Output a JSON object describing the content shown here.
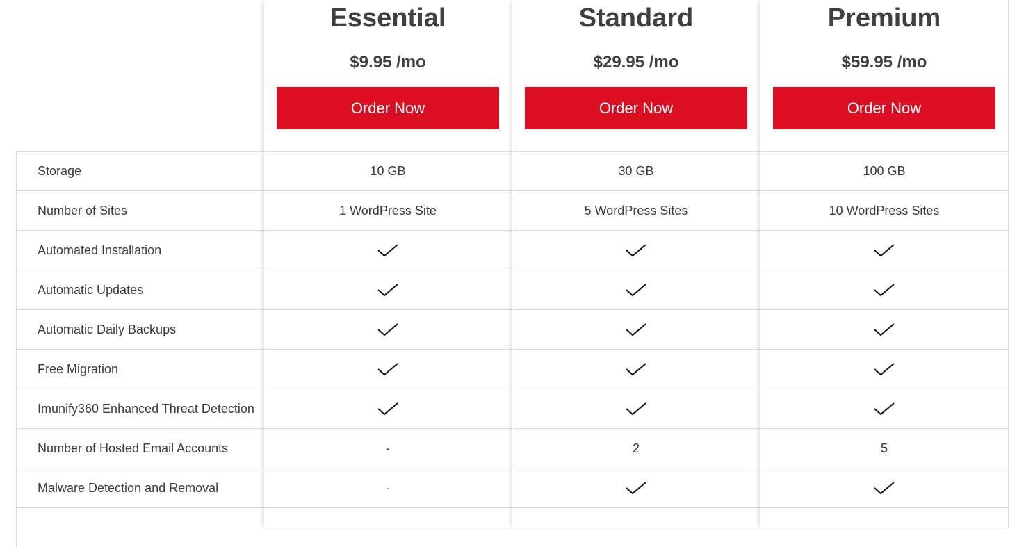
{
  "plans": [
    {
      "name": "Essential",
      "price": "$9.95 /mo",
      "button": "Order Now"
    },
    {
      "name": "Standard",
      "price": "$29.95 /mo",
      "button": "Order Now"
    },
    {
      "name": "Premium",
      "price": "$59.95 /mo",
      "button": "Order Now"
    }
  ],
  "features": [
    {
      "label": "Storage",
      "values": [
        "10 GB",
        "30 GB",
        "100 GB"
      ]
    },
    {
      "label": "Number of Sites",
      "values": [
        "1 WordPress Site",
        "5 WordPress Sites",
        "10 WordPress Sites"
      ]
    },
    {
      "label": "Automated Installation",
      "values": [
        "check-icon",
        "check-icon",
        "check-icon"
      ]
    },
    {
      "label": "Automatic Updates",
      "values": [
        "check-icon",
        "check-icon",
        "check-icon"
      ]
    },
    {
      "label": "Automatic Daily Backups",
      "values": [
        "check-icon",
        "check-icon",
        "check-icon"
      ]
    },
    {
      "label": "Free Migration",
      "values": [
        "check-icon",
        "check-icon",
        "check-icon"
      ]
    },
    {
      "label": "Imunify360 Enhanced Threat Detection",
      "values": [
        "check-icon",
        "check-icon",
        "check-icon"
      ]
    },
    {
      "label": "Number of Hosted Email Accounts",
      "values": [
        "-",
        "2",
        "5"
      ]
    },
    {
      "label": "Malware Detection and Removal",
      "values": [
        "-",
        "check-icon",
        "check-icon"
      ]
    }
  ],
  "colors": {
    "accent": "#dc0f22",
    "text": "#3c3c3c",
    "border": "#dcdcdc"
  }
}
